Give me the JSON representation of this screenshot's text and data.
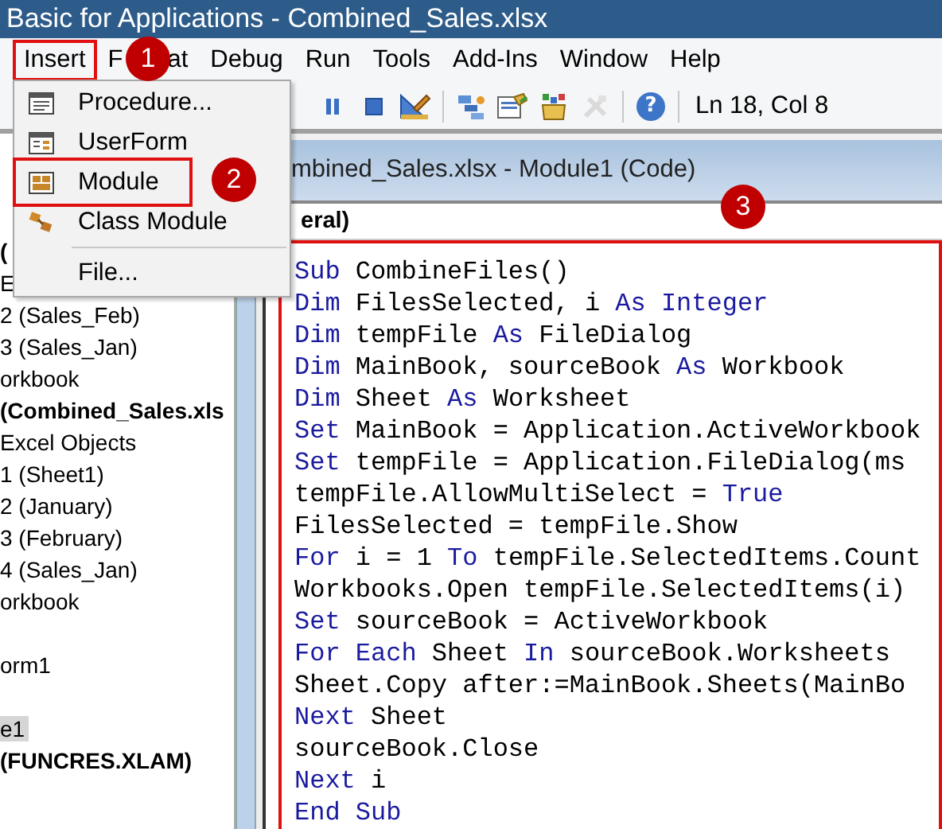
{
  "window": {
    "title": "Basic for Applications - Combined_Sales.xlsx"
  },
  "menu_bar": [
    {
      "label": "Insert",
      "annotated": true
    },
    {
      "label": "F",
      "label_end": "at",
      "annotated": false
    },
    {
      "label": "Debug",
      "annotated": false
    },
    {
      "label": "Run",
      "annotated": false
    },
    {
      "label": "Tools",
      "annotated": false
    },
    {
      "label": "Add-Ins",
      "annotated": false
    },
    {
      "label": "Window",
      "annotated": false
    },
    {
      "label": "Help",
      "annotated": false
    }
  ],
  "insert_menu": [
    {
      "kind": "procedure",
      "label": "Procedure...",
      "annotated": false
    },
    {
      "kind": "userform",
      "label": "UserForm",
      "annotated": false
    },
    {
      "kind": "module",
      "label": "Module",
      "annotated": true
    },
    {
      "kind": "class-module",
      "label": "Class Module",
      "annotated": false
    },
    {
      "kind": "separator"
    },
    {
      "kind": "file",
      "label": "File...",
      "annotated": false
    }
  ],
  "toolbar": {
    "buttons": [
      {
        "kind": "pause",
        "disabled": false
      },
      {
        "kind": "stop",
        "disabled": false
      },
      {
        "kind": "design-mode",
        "disabled": false
      },
      {
        "kind": "separator"
      },
      {
        "kind": "project-explorer",
        "disabled": false
      },
      {
        "kind": "properties",
        "disabled": false
      },
      {
        "kind": "object-browser",
        "disabled": false
      },
      {
        "kind": "toolbox",
        "disabled": true
      },
      {
        "kind": "separator"
      },
      {
        "kind": "help",
        "glyph": "?",
        "disabled": false
      },
      {
        "kind": "separator"
      }
    ],
    "position": "Ln 18, Col 8"
  },
  "project_explorer": [
    {
      "kind": "project",
      "label": "(",
      "selected": false
    },
    {
      "kind": "folder",
      "label": "E",
      "selected": false
    },
    {
      "kind": "item",
      "label": "2 (Sales_Feb)",
      "selected": false
    },
    {
      "kind": "item",
      "label": "3 (Sales_Jan)",
      "selected": false
    },
    {
      "kind": "item",
      "label": "orkbook",
      "selected": false
    },
    {
      "kind": "project",
      "label": "(Combined_Sales.xls",
      "selected": false
    },
    {
      "kind": "folder",
      "label": "Excel Objects",
      "selected": false
    },
    {
      "kind": "item",
      "label": "1 (Sheet1)",
      "selected": false
    },
    {
      "kind": "item",
      "label": "2 (January)",
      "selected": false
    },
    {
      "kind": "item",
      "label": "3 (February)",
      "selected": false
    },
    {
      "kind": "item",
      "label": "4 (Sales_Jan)",
      "selected": false
    },
    {
      "kind": "item",
      "label": "orkbook",
      "selected": false
    },
    {
      "kind": "folder",
      "selected": false
    },
    {
      "kind": "item",
      "label": "orm1",
      "selected": false
    },
    {
      "kind": "folder",
      "selected": false
    },
    {
      "kind": "item",
      "label": "e1",
      "selected": true
    },
    {
      "kind": "project",
      "label": "(FUNCRES.XLAM)",
      "selected": false
    }
  ],
  "code_window": {
    "title": "mbined_Sales.xlsx - Module1 (Code)",
    "object_box": "eral)",
    "annotated": true,
    "lines": [
      [
        {
          "kind": "keyword",
          "text": "Sub"
        },
        {
          "kind": "plain",
          "text": " CombineFiles()"
        }
      ],
      [
        {
          "kind": "keyword",
          "text": "Dim"
        },
        {
          "kind": "plain",
          "text": " FilesSelected, i "
        },
        {
          "kind": "keyword",
          "text": "As Integer"
        }
      ],
      [
        {
          "kind": "keyword",
          "text": "Dim"
        },
        {
          "kind": "plain",
          "text": " tempFile "
        },
        {
          "kind": "keyword",
          "text": "As"
        },
        {
          "kind": "plain",
          "text": " FileDialog"
        }
      ],
      [
        {
          "kind": "keyword",
          "text": "Dim"
        },
        {
          "kind": "plain",
          "text": " MainBook, sourceBook "
        },
        {
          "kind": "keyword",
          "text": "As"
        },
        {
          "kind": "plain",
          "text": " Workbook"
        }
      ],
      [
        {
          "kind": "keyword",
          "text": "Dim"
        },
        {
          "kind": "plain",
          "text": " Sheet "
        },
        {
          "kind": "keyword",
          "text": "As"
        },
        {
          "kind": "plain",
          "text": " Worksheet"
        }
      ],
      [
        {
          "kind": "keyword",
          "text": "Set"
        },
        {
          "kind": "plain",
          "text": " MainBook = Application.ActiveWorkbook"
        }
      ],
      [
        {
          "kind": "keyword",
          "text": "Set"
        },
        {
          "kind": "plain",
          "text": " tempFile = Application.FileDialog(ms"
        }
      ],
      [
        {
          "kind": "plain",
          "text": "tempFile.AllowMultiSelect = "
        },
        {
          "kind": "keyword",
          "text": "True"
        }
      ],
      [
        {
          "kind": "plain",
          "text": "FilesSelected = tempFile.Show"
        }
      ],
      [
        {
          "kind": "keyword",
          "text": "For"
        },
        {
          "kind": "plain",
          "text": " i = 1 "
        },
        {
          "kind": "keyword",
          "text": "To"
        },
        {
          "kind": "plain",
          "text": " tempFile.SelectedItems.Count"
        }
      ],
      [
        {
          "kind": "plain",
          "text": "Workbooks.Open tempFile.SelectedItems(i)"
        }
      ],
      [
        {
          "kind": "keyword",
          "text": "Set"
        },
        {
          "kind": "plain",
          "text": " sourceBook = ActiveWorkbook"
        }
      ],
      [
        {
          "kind": "keyword",
          "text": "For Each"
        },
        {
          "kind": "plain",
          "text": " Sheet "
        },
        {
          "kind": "keyword",
          "text": "In"
        },
        {
          "kind": "plain",
          "text": " sourceBook.Worksheets"
        }
      ],
      [
        {
          "kind": "plain",
          "text": "Sheet.Copy after:=MainBook.Sheets(MainBo"
        }
      ],
      [
        {
          "kind": "keyword",
          "text": "Next"
        },
        {
          "kind": "plain",
          "text": " Sheet"
        }
      ],
      [
        {
          "kind": "plain",
          "text": "sourceBook.Close"
        }
      ],
      [
        {
          "kind": "keyword",
          "text": "Next"
        },
        {
          "kind": "plain",
          "text": " i"
        }
      ],
      [
        {
          "kind": "keyword",
          "text": "End Sub"
        }
      ]
    ]
  },
  "annotations": [
    {
      "number": "1"
    },
    {
      "number": "2"
    },
    {
      "number": "3"
    }
  ]
}
